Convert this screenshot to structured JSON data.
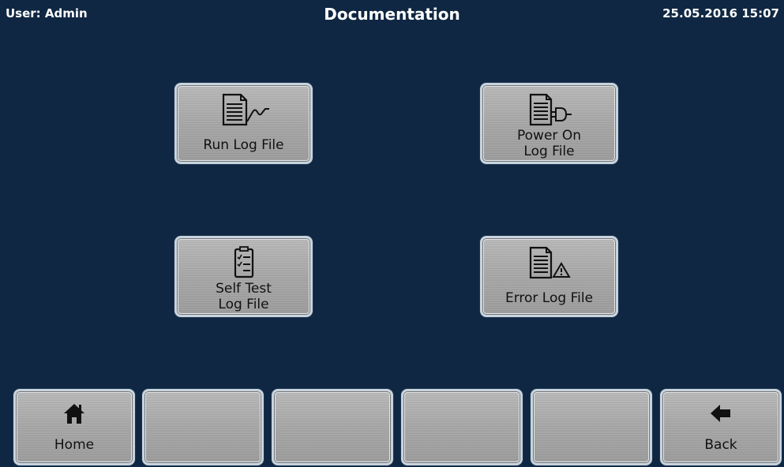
{
  "header": {
    "user": "User: Admin",
    "title": "Documentation",
    "datetime": "25.05.2016  15:07"
  },
  "main": {
    "buttons": [
      {
        "id": "run",
        "lines": [
          "Run Log File"
        ],
        "icon": "document-waveform-icon"
      },
      {
        "id": "power",
        "lines": [
          "Power On",
          "Log File"
        ],
        "icon": "document-plug-icon"
      },
      {
        "id": "self",
        "lines": [
          "Self Test",
          "Log File"
        ],
        "icon": "checklist-document-icon"
      },
      {
        "id": "error",
        "lines": [
          "Error Log File"
        ],
        "icon": "document-warning-icon"
      }
    ]
  },
  "bottom_bar": {
    "home_label": "Home",
    "back_label": "Back",
    "home_icon": "home-icon",
    "back_icon": "back-arrow-icon"
  },
  "colors": {
    "background": "#0f2742",
    "header_text": "#ffffff",
    "button_face": "#a9a9a9",
    "button_text": "#111111"
  }
}
